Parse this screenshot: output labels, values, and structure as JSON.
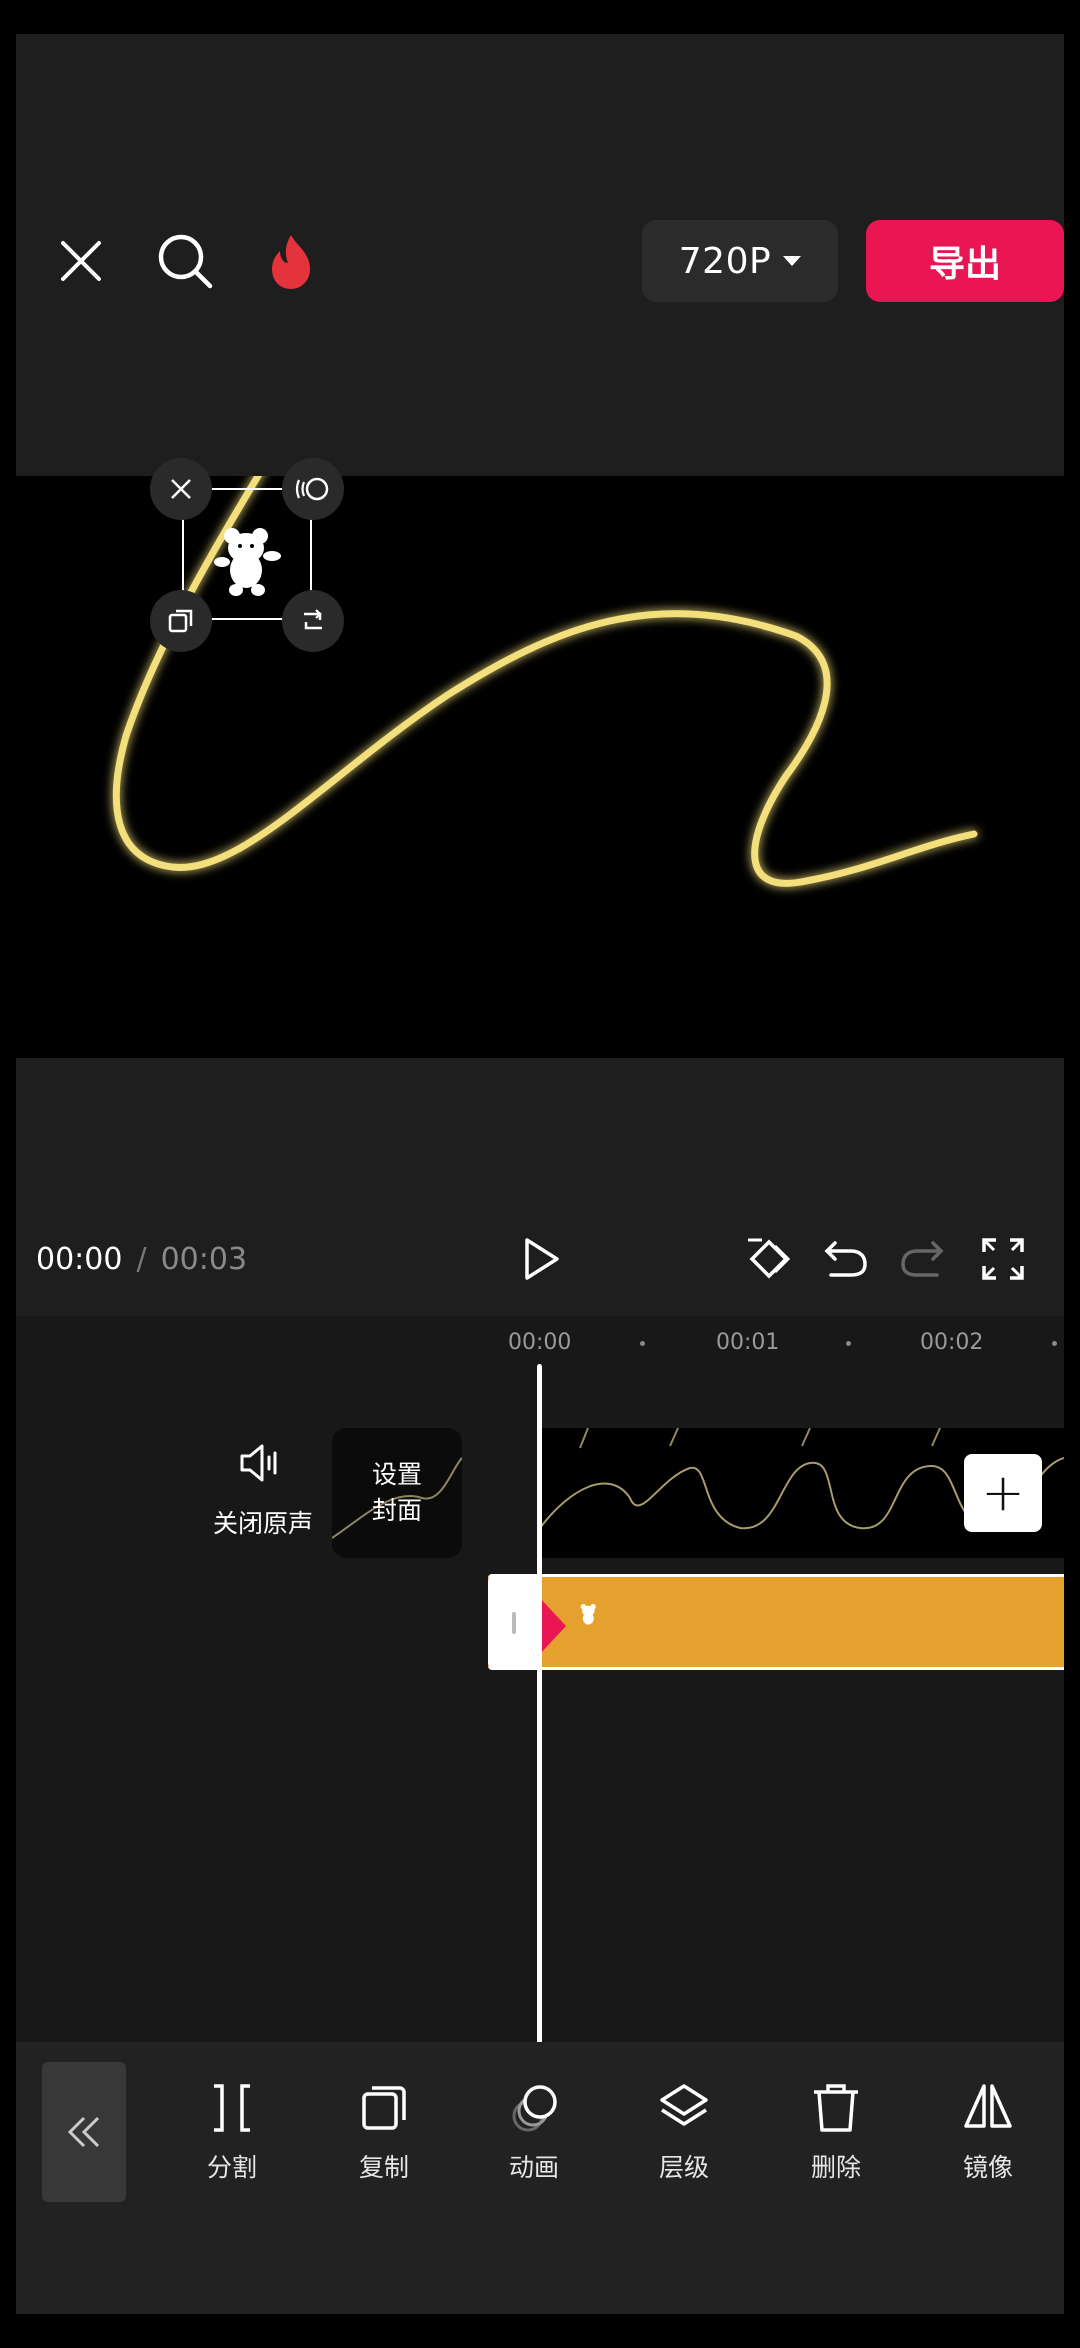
{
  "topbar": {
    "close_icon": "close-icon",
    "search_icon": "search-icon",
    "hot_icon": "flame-icon",
    "resolution": "720P",
    "export_label": "导出"
  },
  "playback": {
    "current_time": "00:00",
    "separator": "/",
    "total_time": "00:03"
  },
  "ruler": {
    "marks": [
      "00:00",
      "00:01",
      "00:02"
    ]
  },
  "tracks": {
    "mute_label": "关闭原声",
    "cover_line1": "设置",
    "cover_line2": "封面",
    "add_label": "+"
  },
  "toolbar": {
    "items": [
      {
        "label": "分割",
        "icon": "split-icon"
      },
      {
        "label": "复制",
        "icon": "copy-icon"
      },
      {
        "label": "动画",
        "icon": "animation-icon"
      },
      {
        "label": "层级",
        "icon": "layers-icon"
      },
      {
        "label": "删除",
        "icon": "delete-icon"
      },
      {
        "label": "镜像",
        "icon": "mirror-icon"
      }
    ]
  },
  "colors": {
    "accent": "#ea1653",
    "track": "#e5a12d",
    "stroke": "#f3df7c"
  }
}
